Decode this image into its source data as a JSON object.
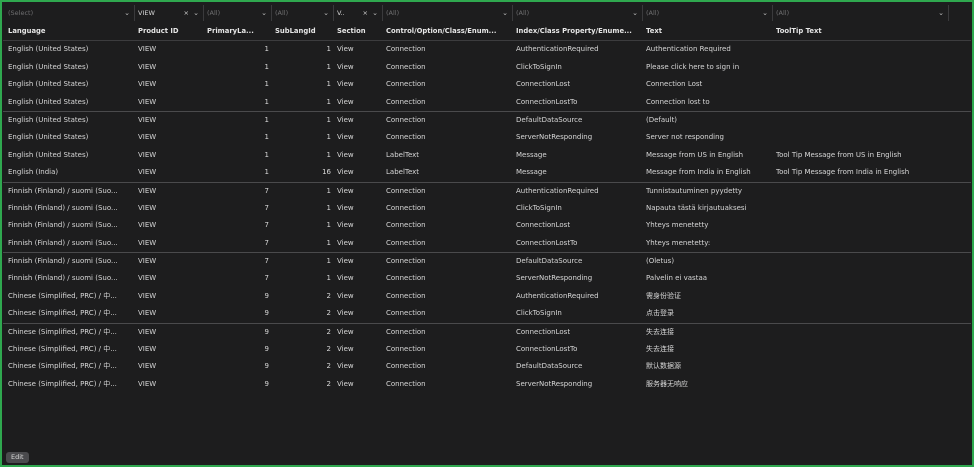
{
  "filters": [
    {
      "placeholder": "(Select)",
      "value": "",
      "clear": false
    },
    {
      "placeholder": "",
      "value": "VIEW",
      "clear": true
    },
    {
      "placeholder": "(All)",
      "value": "",
      "clear": false
    },
    {
      "placeholder": "(All)",
      "value": "",
      "clear": false
    },
    {
      "placeholder": "",
      "value": "V..",
      "clear": true
    },
    {
      "placeholder": "(All)",
      "value": "",
      "clear": false
    },
    {
      "placeholder": "(All)",
      "value": "",
      "clear": false
    },
    {
      "placeholder": "(All)",
      "value": "",
      "clear": false
    },
    {
      "placeholder": "(All)",
      "value": "",
      "clear": false
    }
  ],
  "headers": [
    "Language",
    "Product ID",
    "PrimaryLa...",
    "SubLangId",
    "Section",
    "Control/Option/Class/Enum...",
    "Index/Class Property/Enume...",
    "Text",
    "ToolTip Text"
  ],
  "rows": [
    [
      "English (United States)",
      "VIEW",
      "1",
      "1",
      "View",
      "Connection",
      "AuthenticationRequired",
      "Authentication Required",
      ""
    ],
    [
      "English (United States)",
      "VIEW",
      "1",
      "1",
      "View",
      "Connection",
      "ClickToSignIn",
      "Please click here to sign in",
      ""
    ],
    [
      "English (United States)",
      "VIEW",
      "1",
      "1",
      "View",
      "Connection",
      "ConnectionLost",
      "Connection Lost",
      ""
    ],
    [
      "English (United States)",
      "VIEW",
      "1",
      "1",
      "View",
      "Connection",
      "ConnectionLostTo",
      "Connection lost to",
      ""
    ],
    [
      "English (United States)",
      "VIEW",
      "1",
      "1",
      "View",
      "Connection",
      "DefaultDataSource",
      "(Default)",
      ""
    ],
    [
      "English (United States)",
      "VIEW",
      "1",
      "1",
      "View",
      "Connection",
      "ServerNotResponding",
      "Server not responding",
      ""
    ],
    [
      "English (United States)",
      "VIEW",
      "1",
      "1",
      "View",
      "LabelText",
      "Message",
      "Message from US in English",
      "Tool Tip Message from US in English"
    ],
    [
      "English (India)",
      "VIEW",
      "1",
      "16",
      "View",
      "LabelText",
      "Message",
      "Message from India in English",
      "Tool Tip Message from India in English"
    ],
    [
      "Finnish (Finland) / suomi (Suo...",
      "VIEW",
      "7",
      "1",
      "View",
      "Connection",
      "AuthenticationRequired",
      "Tunnistautuminen pyydetty",
      ""
    ],
    [
      "Finnish (Finland) / suomi (Suo...",
      "VIEW",
      "7",
      "1",
      "View",
      "Connection",
      "ClickToSignIn",
      "Napauta tästä kirjautuaksesi",
      ""
    ],
    [
      "Finnish (Finland) / suomi (Suo...",
      "VIEW",
      "7",
      "1",
      "View",
      "Connection",
      "ConnectionLost",
      "Yhteys menetetty",
      ""
    ],
    [
      "Finnish (Finland) / suomi (Suo...",
      "VIEW",
      "7",
      "1",
      "View",
      "Connection",
      "ConnectionLostTo",
      "Yhteys menetetty:",
      ""
    ],
    [
      "Finnish (Finland) / suomi (Suo...",
      "VIEW",
      "7",
      "1",
      "View",
      "Connection",
      "DefaultDataSource",
      "(Oletus)",
      ""
    ],
    [
      "Finnish (Finland) / suomi (Suo...",
      "VIEW",
      "7",
      "1",
      "View",
      "Connection",
      "ServerNotResponding",
      "Palvelin ei vastaa",
      ""
    ],
    [
      "Chinese (Simplified, PRC) / 中...",
      "VIEW",
      "9",
      "2",
      "View",
      "Connection",
      "AuthenticationRequired",
      "需身份验证",
      ""
    ],
    [
      "Chinese (Simplified, PRC) / 中...",
      "VIEW",
      "9",
      "2",
      "View",
      "Connection",
      "ClickToSignIn",
      "点击登录",
      ""
    ],
    [
      "Chinese (Simplified, PRC) / 中...",
      "VIEW",
      "9",
      "2",
      "View",
      "Connection",
      "ConnectionLost",
      "失去连接",
      ""
    ],
    [
      "Chinese (Simplified, PRC) / 中...",
      "VIEW",
      "9",
      "2",
      "View",
      "Connection",
      "ConnectionLostTo",
      "失去连接",
      ""
    ],
    [
      "Chinese (Simplified, PRC) / 中...",
      "VIEW",
      "9",
      "2",
      "View",
      "Connection",
      "DefaultDataSource",
      "默认数据源",
      ""
    ],
    [
      "Chinese (Simplified, PRC) / 中...",
      "VIEW",
      "9",
      "2",
      "View",
      "Connection",
      "ServerNotResponding",
      "服务器无响应",
      ""
    ]
  ],
  "row_separators_before": [
    4,
    8,
    12,
    16
  ],
  "edit_label": "Edit",
  "colors": {
    "border": "#2fa84f",
    "background": "#1d1d1e",
    "text": "#d8d8d8"
  }
}
